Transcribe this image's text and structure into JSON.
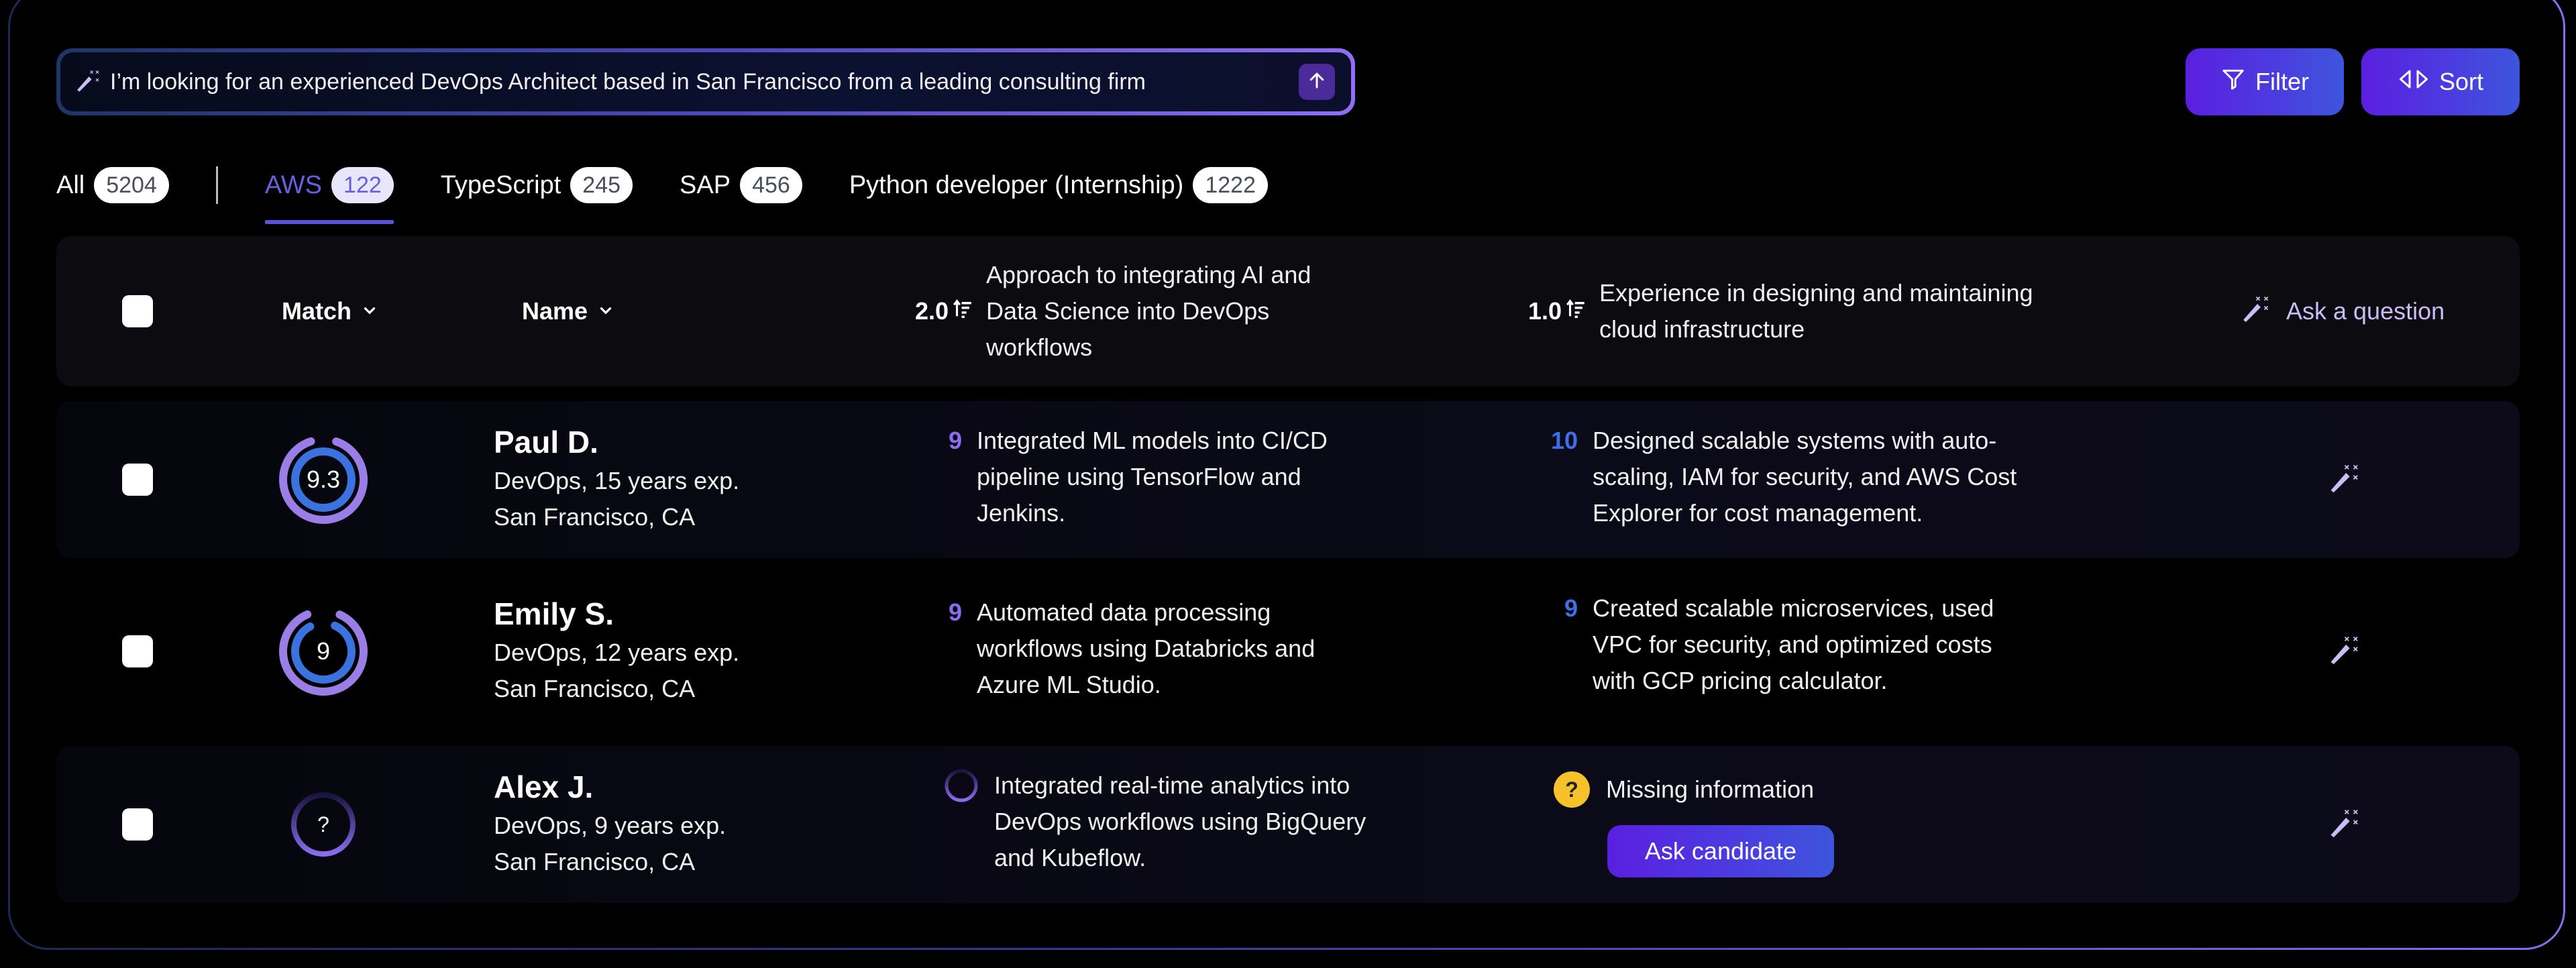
{
  "search": {
    "value": "I’m looking for an experienced DevOps Architect based in San Francisco from a leading consulting firm",
    "icon": "magic-wand-icon",
    "submit_icon": "arrow-up-icon"
  },
  "toolbar": {
    "filter_label": "Filter",
    "sort_label": "Sort"
  },
  "tabs": [
    {
      "label": "All",
      "count": "5204",
      "active": false
    },
    {
      "label": "AWS",
      "count": "122",
      "active": true
    },
    {
      "label": "TypeScript",
      "count": "245",
      "active": false
    },
    {
      "label": "SAP",
      "count": "456",
      "active": false
    },
    {
      "label": "Python developer (Internship)",
      "count": "1222",
      "active": false
    }
  ],
  "table": {
    "headers": {
      "match": "Match",
      "name": "Name",
      "q1_weight": "2.0",
      "q1_text": "Approach to integrating AI and Data Science into DevOps workflows",
      "q2_weight": "1.0",
      "q2_text": "Experience in designing and maintaining cloud infrastructure",
      "ask": "Ask a question"
    },
    "rows": [
      {
        "match": "9.3",
        "match_outer_fraction": 0.93,
        "match_inner_fraction": 1.0,
        "name": "Paul D.",
        "role": "DevOps, 15 years exp.",
        "location": "San Francisco, CA",
        "q1_score": "9",
        "q1_answer": "Integrated ML models into CI/CD pipeline using TensorFlow and Jenkins.",
        "q2_score": "10",
        "q2_answer": "Designed scalable systems with auto-scaling, IAM for security, and AWS Cost Explorer for cost management."
      },
      {
        "match": "9",
        "match_outer_fraction": 0.9,
        "match_inner_fraction": 0.9,
        "name": "Emily S.",
        "role": "DevOps, 12 years exp.",
        "location": "San Francisco, CA",
        "q1_score": "9",
        "q1_answer": "Automated data processing workflows using Databricks and Azure ML Studio.",
        "q2_score": "9",
        "q2_answer": "Created scalable microservices, used VPC for security, and optimized costs with GCP pricing calculator."
      },
      {
        "match": "?",
        "name": "Alex J.",
        "role": "DevOps, 9 years exp.",
        "location": "San Francisco, CA",
        "q1_status": "loading",
        "q1_answer": "Integrated real-time analytics into DevOps workflows using BigQuery and Kubeflow.",
        "q2_status": "Missing information",
        "q2_action": "Ask candidate"
      }
    ]
  },
  "colors": {
    "accent_purple": "#8b6cf0",
    "accent_blue": "#3f6fe8",
    "button_gradient_start": "#5b1fe0",
    "button_gradient_end": "#3d55dc",
    "warning_yellow": "#f5c22a",
    "ask_text": "#cbbcf6"
  }
}
